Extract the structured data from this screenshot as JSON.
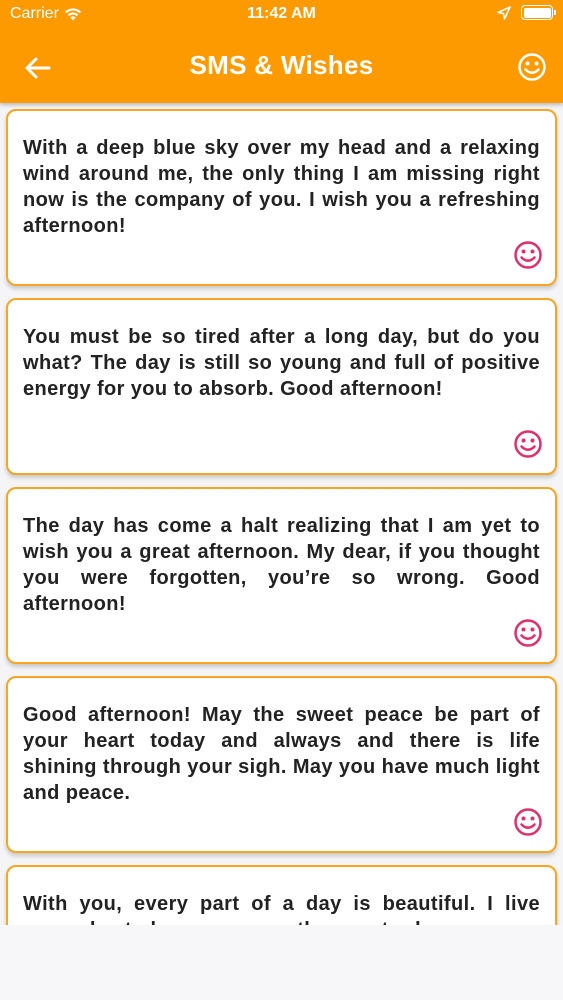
{
  "status_bar": {
    "carrier": "Carrier",
    "time": "11:42 AM"
  },
  "header": {
    "title": "SMS & Wishes",
    "background_color": "#fd9a00"
  },
  "icons": {
    "back": "arrow-left-icon",
    "header_right": "smiley-icon",
    "card_action": "smiley-icon"
  },
  "colors": {
    "card_border": "#f5a622",
    "card_smiley": "#e0306a",
    "text": "#222222"
  },
  "wishes": [
    {
      "text": "With a deep blue sky over my head and a relaxing wind around me, the only thing I am missing right now is the company of you. I wish you a refreshing afternoon!"
    },
    {
      "text": "You must be so tired after a long day, but do you what? The day is still so young and full of positive energy for you to absorb. Good afternoon!"
    },
    {
      "text": "The day has come a halt realizing that I am yet to wish you a great afternoon. My dear, if you thought you were forgotten, you’re so wrong. Good afternoon!"
    },
    {
      "text": "Good afternoon! May the sweet peace be part of your heart today and always and there is life shining through your sigh. May you have much light and peace."
    },
    {
      "text": "With you, every part of a day is beautiful. I live every day to love you more than yesterday."
    }
  ]
}
